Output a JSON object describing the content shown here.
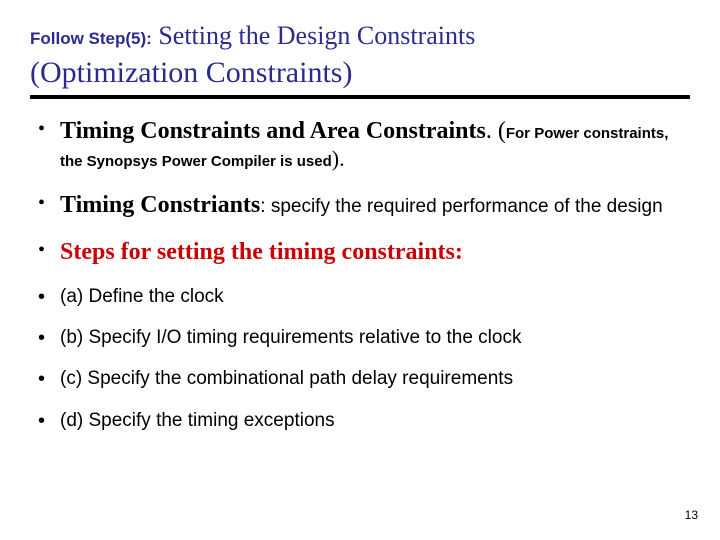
{
  "title": {
    "prefix": "Follow Step(5):",
    "main1": "Setting the Design Constraints",
    "main2": "(Optimization Constraints)"
  },
  "bullets": {
    "b1_head": "Timing Constraints and Area Constraints",
    "b1_tail1": ". (",
    "b1_note": "For Power constraints, the Synopsys Power Compiler is used",
    "b1_tail2": ").",
    "b2_head": "Timing Constriants",
    "b2_tail": ": specify the required performance of the design",
    "b3": "Steps for setting the timing constraints:",
    "sub_a": "(a) Define the clock",
    "sub_b": "(b) Specify I/O timing requirements relative to the clock",
    "sub_c": "(c) Specify the combinational path delay requirements",
    "sub_d": "(d) Specify the timing exceptions"
  },
  "page_number": "13"
}
